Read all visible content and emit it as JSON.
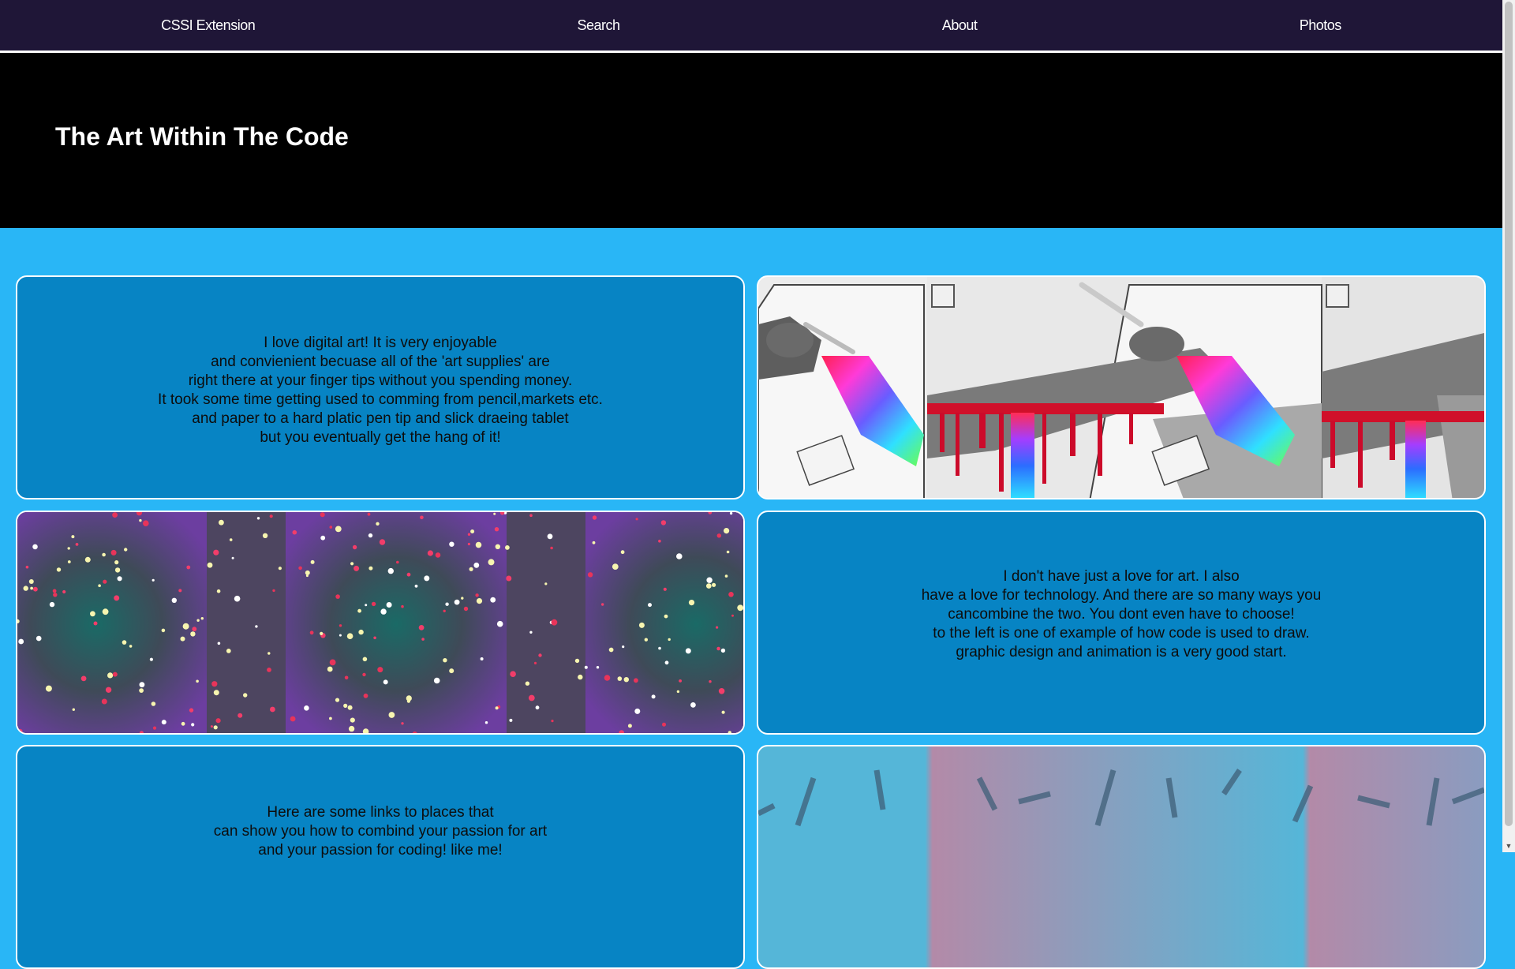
{
  "nav": {
    "items": [
      "CSSI Extension",
      "Search",
      "About",
      "Photos"
    ]
  },
  "hero": {
    "title": "The Art Within The Code"
  },
  "cards": {
    "card1_lines": [
      "I love digital art! It is very enjoyable",
      "and convienient becuase all of the 'art supplies' are",
      "right there at your finger tips without you spending money.",
      "It took some time getting used to comming from pencil,markets etc.",
      "and paper to a hard platic pen tip and slick draeing tablet",
      "but you eventually get the hang of it!"
    ],
    "card4_lines": [
      "I don't have just a love for art. I also",
      "have a love for technology. And there are so many ways you",
      "cancombine the two. You dont even have to choose!",
      "to the left is one of example of how code is used to draw.",
      "graphic design and animation is a very good start."
    ],
    "card5_lines": [
      "Here are some links to places that",
      "can show you how to combind your passion for art",
      "and your passion for coding! like me!"
    ]
  },
  "colors": {
    "nav_bg": "#1f1637",
    "hero_bg": "#000000",
    "page_bg": "#29b6f6",
    "card_bg": "#0784c4"
  }
}
